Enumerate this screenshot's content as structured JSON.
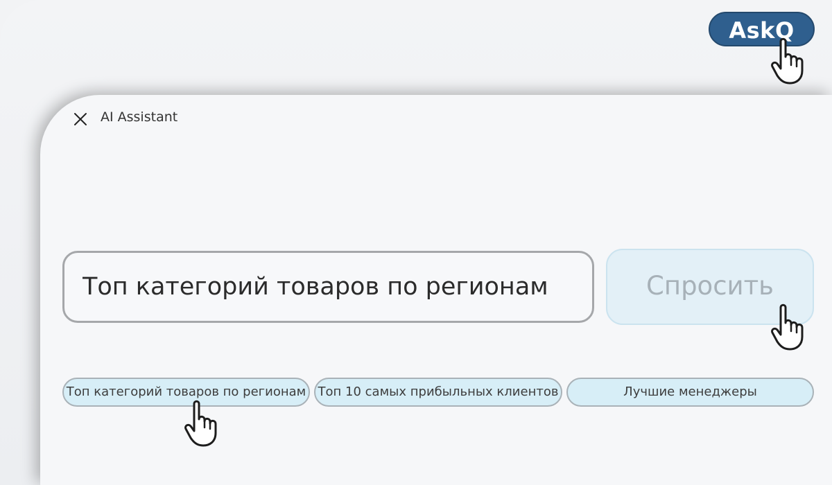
{
  "launcher": {
    "label": "AskQ"
  },
  "assistant": {
    "title": "AI Assistant",
    "query_value": "Топ категорий товаров по регионам",
    "ask_label": "Спросить",
    "suggestions": [
      {
        "label": "Топ категорий товаров по регионам"
      },
      {
        "label": "Топ 10 самых прибыльных клиентов"
      },
      {
        "label": "Лучшие менеджеры"
      }
    ]
  },
  "icons": {
    "close": "close-icon",
    "cursor": "hand-pointer-icon"
  },
  "colors": {
    "launcher_bg": "#2f5f8e",
    "ask_button_bg": "#e3f0f7",
    "chip_bg": "#d7eef7",
    "panel_bg": "#f6f7f9"
  }
}
